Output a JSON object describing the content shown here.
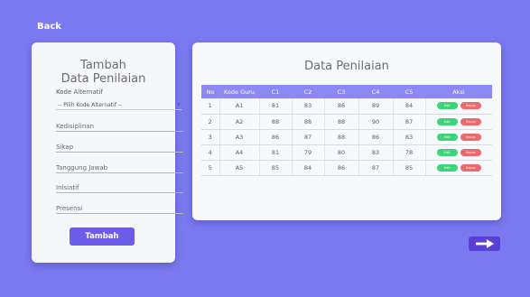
{
  "nav": {
    "back_label": "Back"
  },
  "form": {
    "title_line1": "Tambah",
    "title_line2": "Data Penilaian",
    "kode_alternatif_label": "Kode Alternatif",
    "kode_alternatif_value": "-- Pilih Kode Alternatif --",
    "kedisiplinan_placeholder": "Kedisiplinan",
    "sikap_placeholder": "Sikap",
    "tanggung_jawab_placeholder": "Tanggung Jawab",
    "inisiatif_placeholder": "Inisiatif",
    "presensi_placeholder": "Presensi",
    "submit_label": "Tambah"
  },
  "table": {
    "title": "Data Penilaian",
    "headers": [
      "No",
      "Kode Guru",
      "C1",
      "C2",
      "C3",
      "C4",
      "C5",
      "Aksi"
    ],
    "rows": [
      {
        "no": "1",
        "kode": "A1",
        "c1": "81",
        "c2": "83",
        "c3": "86",
        "c4": "89",
        "c5": "84"
      },
      {
        "no": "2",
        "kode": "A2",
        "c1": "88",
        "c2": "88",
        "c3": "88",
        "c4": "90",
        "c5": "87"
      },
      {
        "no": "3",
        "kode": "A3",
        "c1": "86",
        "c2": "87",
        "c3": "88",
        "c4": "86",
        "c5": "83"
      },
      {
        "no": "4",
        "kode": "A4",
        "c1": "81",
        "c2": "79",
        "c3": "80",
        "c4": "83",
        "c5": "78"
      },
      {
        "no": "5",
        "kode": "A5",
        "c1": "85",
        "c2": "84",
        "c3": "86",
        "c4": "87",
        "c5": "85"
      }
    ],
    "edit_label": "Edit",
    "hapus_label": "Hapus"
  },
  "icons": {
    "next": "arrow-right-icon",
    "select": "caret-down-icon"
  },
  "colors": {
    "background": "#7b79f0",
    "primary": "#6c5ce7",
    "table_header": "#8c89f5",
    "edit": "#3ed27a",
    "hapus": "#ec6a6a"
  }
}
